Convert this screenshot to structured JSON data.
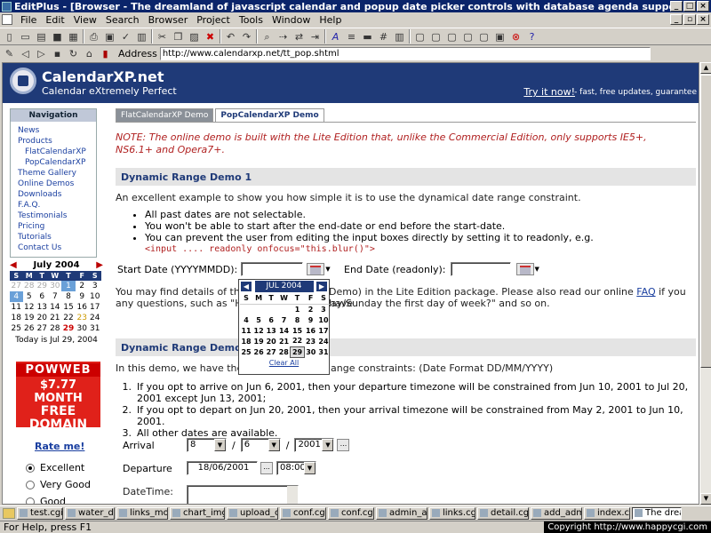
{
  "window": {
    "title": "EditPlus - [Browser - The dreamland of javascript calendar and popup date picker controls with database agenda support!]"
  },
  "menu": [
    "File",
    "Edit",
    "View",
    "Search",
    "Browser",
    "Project",
    "Tools",
    "Window",
    "Help"
  ],
  "address": {
    "label": "Address",
    "url": "http://www.calendarxp.net/tt_pop.shtml"
  },
  "banner": {
    "site_name": "CalendarXP.net",
    "tagline": "Calendar eXtremely Perfect",
    "try_now": "Try it now!",
    "try_desc": "- fast, free updates, guarantee"
  },
  "nav": {
    "heading": "Navigation",
    "items": [
      "News",
      "Products",
      "FlatCalendarXP",
      "PopCalendarXP",
      "Theme Gallery",
      "Online Demos",
      "Downloads",
      "F.A.Q.",
      "Testimonials",
      "Pricing",
      "Tutorials",
      "Contact Us"
    ]
  },
  "mini_calendar": {
    "month": "July 2004",
    "prev": "◀",
    "next": "▶",
    "weekdays": [
      "S",
      "M",
      "T",
      "W",
      "T",
      "F",
      "S"
    ],
    "weeks": [
      [
        "27",
        "28",
        "29",
        "30",
        "1",
        "2",
        "3"
      ],
      [
        "4",
        "5",
        "6",
        "7",
        "8",
        "9",
        "10"
      ],
      [
        "11",
        "12",
        "13",
        "14",
        "15",
        "16",
        "17"
      ],
      [
        "18",
        "19",
        "20",
        "21",
        "22",
        "23",
        "24"
      ],
      [
        "25",
        "26",
        "27",
        "28",
        "29",
        "30",
        "31"
      ]
    ],
    "today_text": "Today is Jul 29, 2004"
  },
  "ad": {
    "brand": "POWWEB",
    "price": "$7.77 MONTH",
    "line1": "FREE",
    "line2": "DOMAIN"
  },
  "rate": {
    "title": "Rate me!",
    "options": [
      "Excellent",
      "Very Good",
      "Good"
    ],
    "selected": "Excellent"
  },
  "tabs": [
    "FlatCalendarXP Demo",
    "PopCalendarXP Demo"
  ],
  "active_tab": "PopCalendarXP Demo",
  "note": "NOTE: The online demo is built with the Lite Edition that, unlike the Commercial Edition, only supports IE5+, NS6.1+ and Opera7+.",
  "demo1": {
    "heading": "Dynamic Range Demo 1",
    "intro": "An excellent example to show you how simple it is to use the dynamical date range constraint.",
    "bullets": [
      "All past dates are not selectable.",
      "You won't be able to start after the end-date or end before the start-date.",
      "You can prevent the user from editing the input boxes directly by setting it to readonly, e.g."
    ],
    "code": "<input .... readonly onfocus=\"this.blur()\">",
    "start_label": "Start Date (YYYYMMDD):",
    "start_value": "",
    "end_label": "End Date (readonly):",
    "end_value": "",
    "details_part1": "You may find details of thi",
    "details_part2": "Demo) in the Lite Edition package. Please also read our online",
    "faq_link": "FAQ",
    "details_part3": "if you have",
    "details_line2a": "any questions, such as \"Ho",
    "details_line2b": "ay/Sunday the first day of week?\" and so on."
  },
  "popup_calendar": {
    "month": "JUL 2004",
    "prev": "◀",
    "next": "▶",
    "weekdays": [
      "S",
      "M",
      "T",
      "W",
      "T",
      "F",
      "S"
    ],
    "weeks": [
      [
        "",
        "",
        "",
        "",
        "1",
        "2",
        "3"
      ],
      [
        "4",
        "5",
        "6",
        "7",
        "8",
        "9",
        "10"
      ],
      [
        "11",
        "12",
        "13",
        "14",
        "15",
        "16",
        "17"
      ],
      [
        "18",
        "19",
        "20",
        "21",
        "22",
        "23",
        "24"
      ],
      [
        "25",
        "26",
        "27",
        "28",
        "29",
        "30",
        "31"
      ]
    ],
    "today": "29",
    "clear_label": "Clear All"
  },
  "demo2": {
    "heading": "Dynamic Range Demo 2",
    "intro_part1": "In this demo, we have the",
    "intro_part2": "ange constraints: (Date Format DD/MM/YYYY)",
    "items": [
      "If you opt to arrive on Jun 6, 2001, then your departure timezone will be constrained from Jun 10, 2001 to Jul 20, 2001 except Jun 13, 2001;",
      "If you opt to depart on Jun 20, 2001, then your arrival timezone will be constrained from May 2, 2001 to Jun 10, 2001.",
      "All other dates are available."
    ],
    "arrival_label": "Arrival",
    "arrival_day": "8",
    "arrival_month": "6",
    "arrival_year": "2001",
    "departure_label": "Departure",
    "departure_date": "18/06/2001",
    "departure_time": "08:00",
    "datetime_label": "DateTime:",
    "dots": "..."
  },
  "taskbar": {
    "tasks": [
      "test.cgi",
      "water_dir.c",
      "links_modif",
      "chart_img.(",
      "upload_cor",
      "conf.cgi",
      "conf.cgi",
      "admin_add",
      "links.cgi",
      "detail.cgi",
      "add_admin",
      "index.cgi",
      "The dream"
    ],
    "active": "The dream"
  },
  "status": {
    "left": "For Help, press F1",
    "right": "Copyright  http://www.happycgi.com"
  }
}
